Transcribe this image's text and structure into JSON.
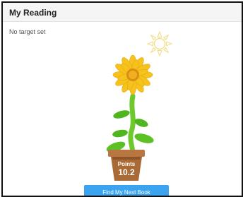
{
  "widget": {
    "title": "My Reading",
    "target_text": "No target set"
  },
  "illustration": {
    "sun_icon": "sun-outline-icon",
    "flower_icon": "sunflower-icon",
    "pot_icon": "flower-pot-icon",
    "colors": {
      "sun_outline": "#f2df8c",
      "petals": "#f6c21c",
      "flower_center": "#d98e12",
      "stem": "#6fc92c",
      "leaf": "#4fb61f",
      "pot": "#a96a36"
    }
  },
  "points": {
    "label": "Points",
    "value": "10.2"
  },
  "actions": {
    "find_book_label": "Find My Next Book",
    "button_color": "#3aa4f0"
  }
}
